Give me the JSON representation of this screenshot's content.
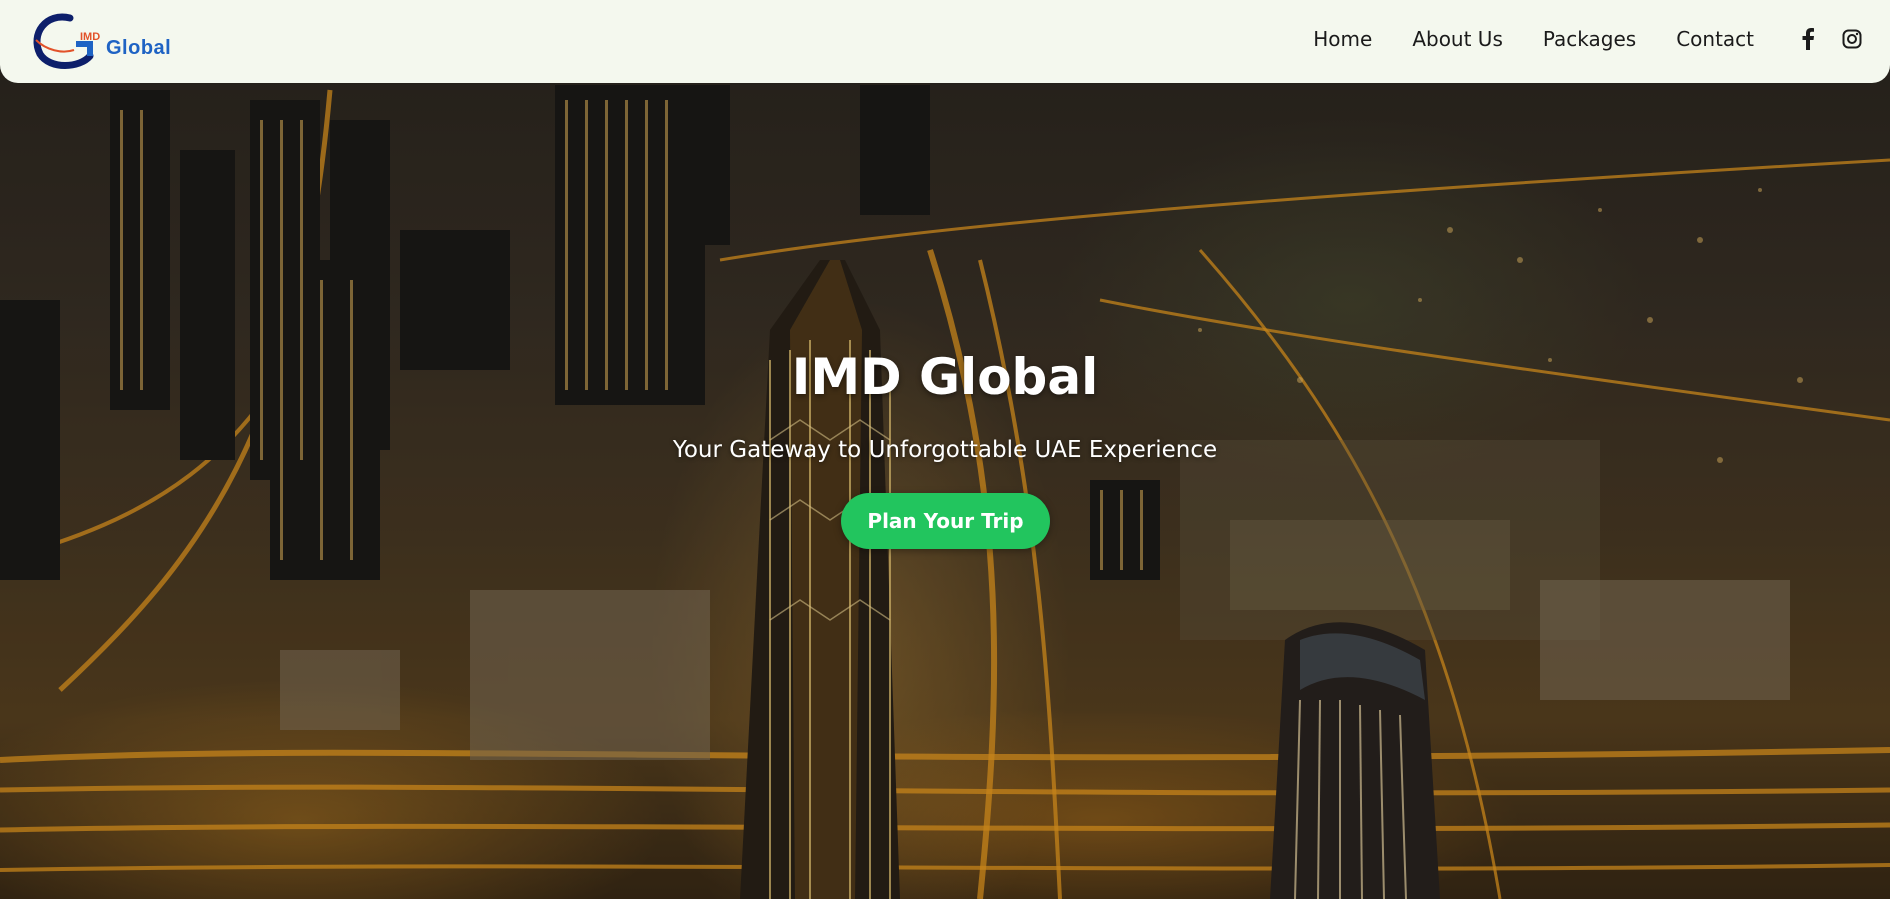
{
  "header": {
    "logo": {
      "small_text": "IMD",
      "text": "Global"
    },
    "nav": [
      {
        "label": "Home"
      },
      {
        "label": "About Us"
      },
      {
        "label": "Packages"
      },
      {
        "label": "Contact"
      }
    ],
    "social": [
      {
        "icon": "facebook-icon"
      },
      {
        "icon": "instagram-icon"
      }
    ]
  },
  "hero": {
    "title": "IMD Global",
    "subtitle": "Your Gateway to Unforgottable UAE Experience",
    "cta_label": "Plan Your Trip"
  },
  "colors": {
    "header_bg": "#f4f8ee",
    "cta_bg": "#22c55e",
    "logo_blue": "#1e63c4",
    "logo_orange": "#e2522a"
  }
}
